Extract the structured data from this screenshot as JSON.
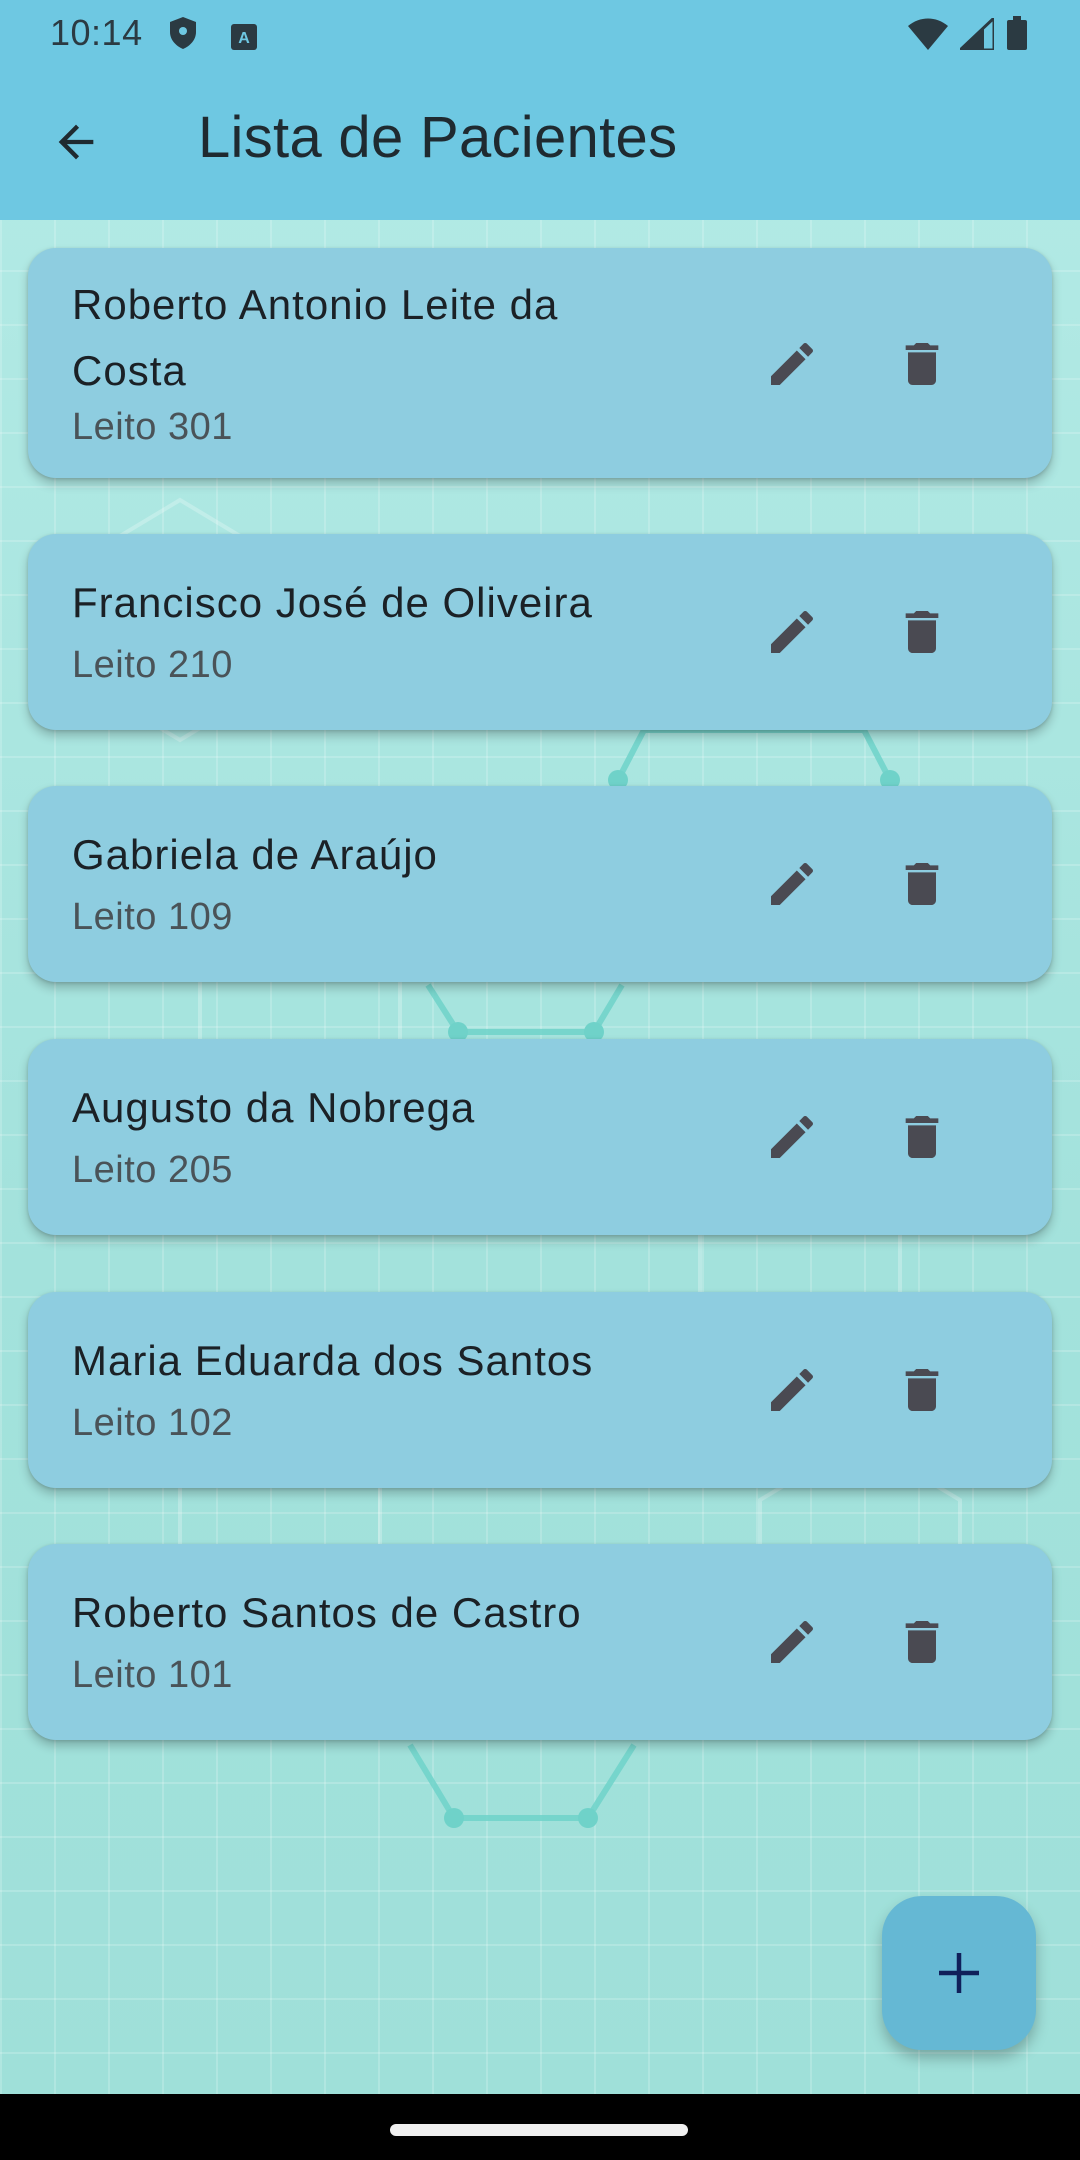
{
  "status_bar": {
    "time": "10:14",
    "left_icons": [
      "shield-icon",
      "font-a-icon"
    ],
    "right_icons": [
      "wifi-icon",
      "signal-icon",
      "battery-icon"
    ]
  },
  "app_bar": {
    "title": "Lista de Pacientes",
    "back_icon": "arrow-left-icon"
  },
  "patients": [
    {
      "name": "Roberto Antonio Leite da Costa",
      "bed": "Leito 301"
    },
    {
      "name": "Francisco José de Oliveira",
      "bed": "Leito 210"
    },
    {
      "name": "Gabriela de Araújo",
      "bed": "Leito 109"
    },
    {
      "name": "Augusto da Nobrega",
      "bed": "Leito 205"
    },
    {
      "name": "Maria Eduarda dos Santos",
      "bed": "Leito 102"
    },
    {
      "name": "Roberto Santos de Castro",
      "bed": "Leito 101"
    }
  ],
  "actions": {
    "edit_icon": "pencil-icon",
    "delete_icon": "trash-icon"
  },
  "fab": {
    "icon": "plus-icon"
  },
  "colors": {
    "app_bar": "#6ec8e2",
    "card": "#8ecde0",
    "background": "#a5e3de",
    "fab": "#65b8d4",
    "icon": "#4a4a52"
  }
}
